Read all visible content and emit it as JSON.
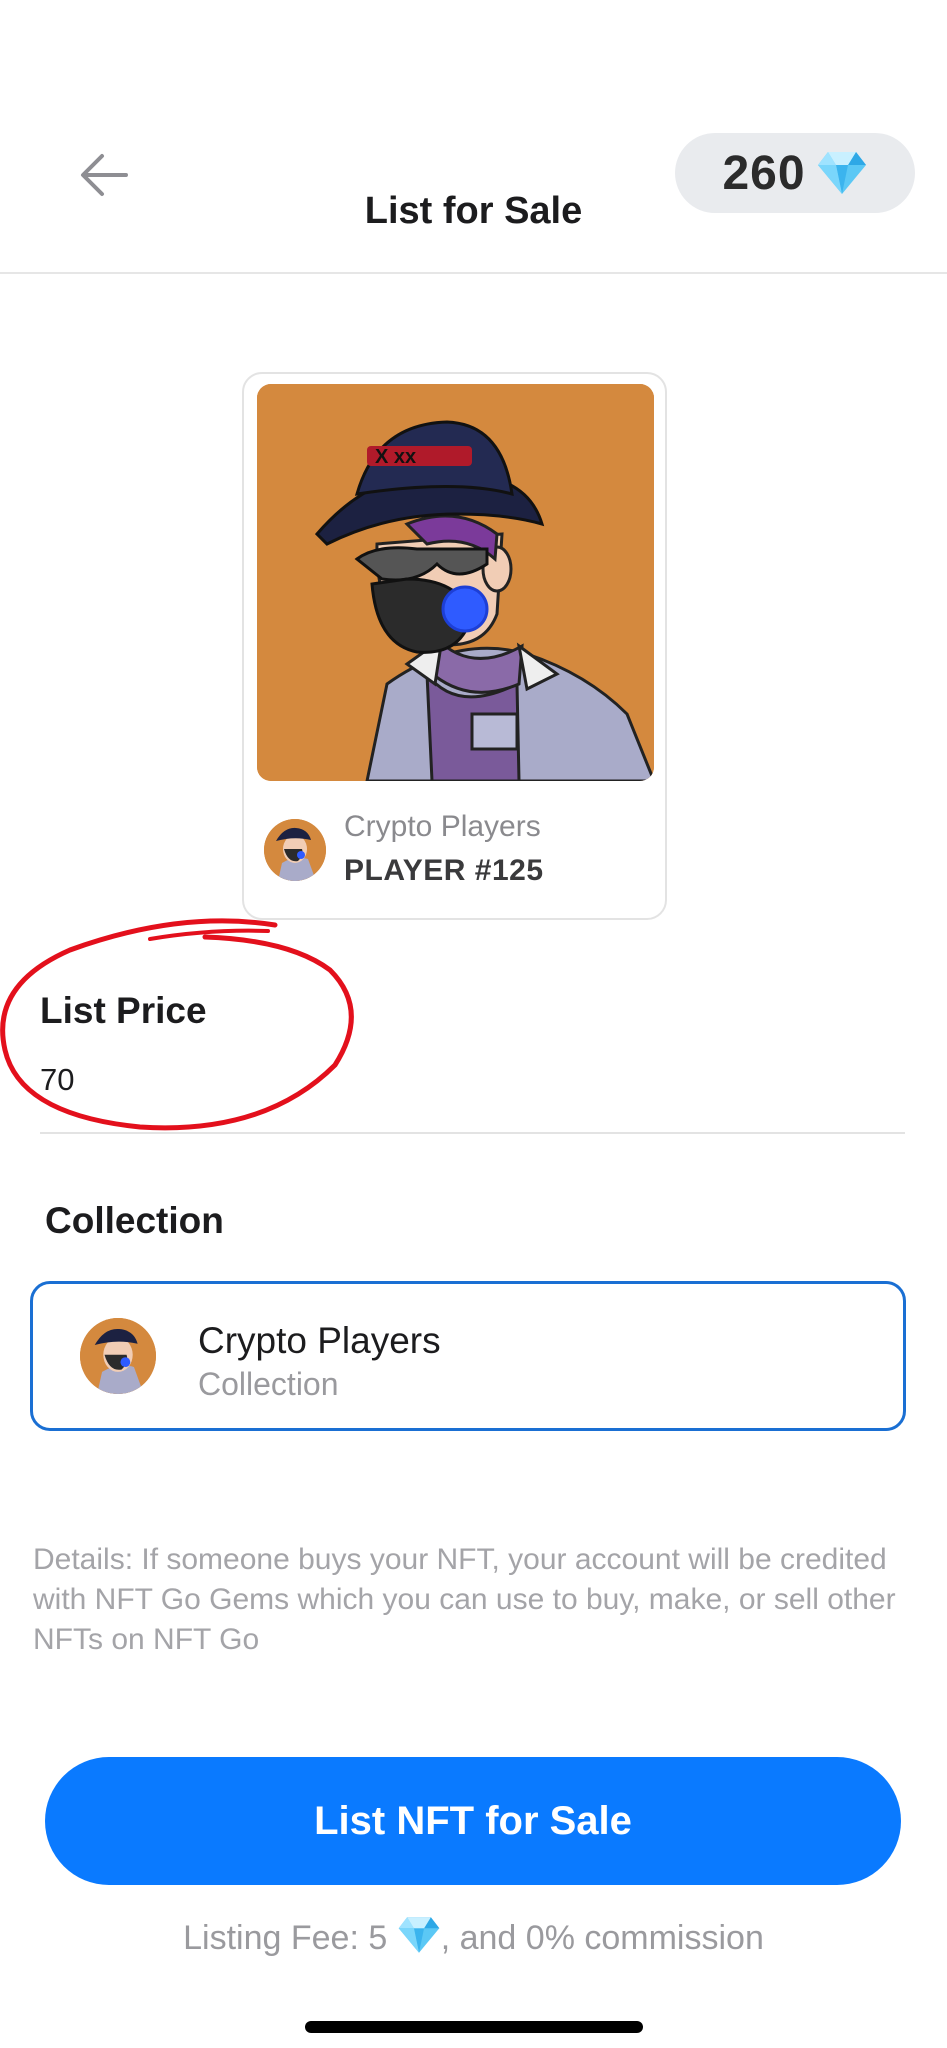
{
  "header": {
    "title": "List for Sale",
    "gem_balance": "260",
    "back_icon": "arrow-left-icon",
    "gem_icon": "diamond-gem-icon"
  },
  "nft_card": {
    "collection": "Crypto Players",
    "token_name": "PLAYER #125",
    "background_color": "#d4893e"
  },
  "list_price": {
    "label": "List Price",
    "value": "70"
  },
  "collection": {
    "label": "Collection",
    "name": "Crypto Players",
    "subtitle": "Collection",
    "border_color": "#1a6fd3"
  },
  "details": {
    "text": "Details: If someone buys your NFT, your account will be credited with NFT Go Gems which you can use to buy, make, or sell other NFTs on NFT Go"
  },
  "cta": {
    "label": "List NFT for Sale",
    "color": "#0a7aff"
  },
  "fee": {
    "prefix": "Listing Fee: 5",
    "suffix": ", and 0% commission"
  }
}
